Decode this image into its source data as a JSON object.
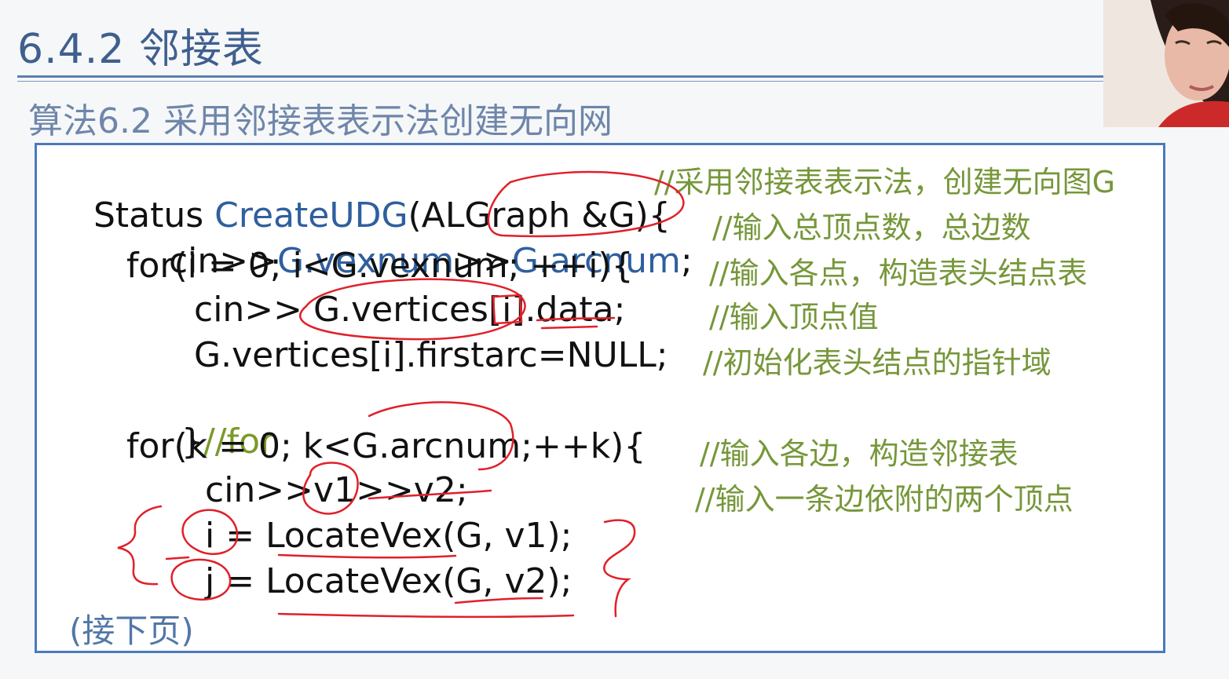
{
  "slide": {
    "title": "6.4.2 邻接表",
    "subtitle": "算法6.2 采用邻接表表示法创建无向网",
    "next_page": "(接下页)"
  },
  "code": {
    "l1_a": "Status ",
    "l1_b": "CreateUDG",
    "l1_c": "(ALGraph &G){",
    "l2_a": "cin>>",
    "l2_b": "G.vexnum",
    "l2_c": ">>",
    "l2_d": "G.arcnum",
    "l2_e": ";",
    "l3": "for(i = 0; i<G.vexnum; ++i){",
    "l4": "cin>> G.vertices[i].data;",
    "l5": "G.vertices[i].firstarc=NULL;",
    "l6_a": "}",
    "l6_b": "//for",
    "l7": "for(k = 0; k<G.arcnum;++k){",
    "l8": "cin>>v1>>v2;",
    "l9": "i = LocateVex(G, v1);",
    "l10": "j = LocateVex(G, v2);"
  },
  "comments": {
    "c1": "//采用邻接表表示法，创建无向图G",
    "c2": "//输入总顶点数，总边数",
    "c3": "//输入各点，构造表头结点表",
    "c4": "//输入顶点值",
    "c5": "//初始化表头结点的指针域",
    "c7": "//输入各边，构造邻接表",
    "c8": "//输入一条边依附的两个顶点"
  },
  "colors": {
    "title": "#3f5f8f",
    "code_blue": "#2f5f9f",
    "comment_green": "#76973a",
    "annotation_red": "#e0202a",
    "box_border": "#4b79bd"
  }
}
